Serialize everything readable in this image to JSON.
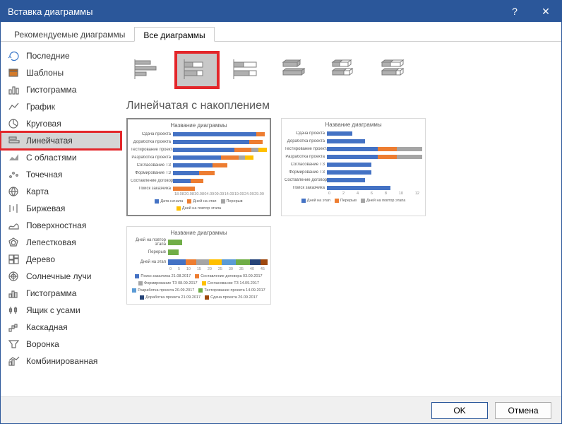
{
  "window": {
    "title": "Вставка диаграммы"
  },
  "tabs": {
    "recommended": "Рекомендуемые диаграммы",
    "all": "Все диаграммы"
  },
  "sidebar": {
    "items": [
      {
        "label": "Последние"
      },
      {
        "label": "Шаблоны"
      },
      {
        "label": "Гистограмма"
      },
      {
        "label": "График"
      },
      {
        "label": "Круговая"
      },
      {
        "label": "Линейчатая"
      },
      {
        "label": "С областями"
      },
      {
        "label": "Точечная"
      },
      {
        "label": "Карта"
      },
      {
        "label": "Биржевая"
      },
      {
        "label": "Поверхностная"
      },
      {
        "label": "Лепестковая"
      },
      {
        "label": "Дерево"
      },
      {
        "label": "Солнечные лучи"
      },
      {
        "label": "Гистограмма"
      },
      {
        "label": "Ящик с усами"
      },
      {
        "label": "Каскадная"
      },
      {
        "label": "Воронка"
      },
      {
        "label": "Комбинированная"
      }
    ]
  },
  "subtitle": "Линейчатая с накоплением",
  "buttons": {
    "ok": "OK",
    "cancel": "Отмена"
  },
  "colors": {
    "s1": "#4472c4",
    "s2": "#ed7d31",
    "s3": "#a5a5a5",
    "s4": "#ffc000",
    "s5": "#5b9bd5",
    "s6": "#70ad47",
    "s7": "#264478",
    "s8": "#9e480e"
  },
  "chart_data": [
    {
      "type": "bar",
      "orientation": "horizontal",
      "stacked": true,
      "title": "Название диаграммы",
      "categories": [
        "Сдача проекта",
        "Доработка проекта",
        "Тестирование проекта",
        "Разработка проекта",
        "Согласование ТЗ",
        "Формирование ТЗ",
        "Составление договора",
        "Поиск заказчика"
      ],
      "series": [
        {
          "name": "Дата начала",
          "values": [
            38,
            35,
            28,
            22,
            18,
            12,
            8,
            0
          ],
          "color": "#4472c4"
        },
        {
          "name": "Дней на этап",
          "values": [
            4,
            6,
            8,
            8,
            7,
            7,
            6,
            10
          ],
          "color": "#ed7d31"
        },
        {
          "name": "Перерыв",
          "values": [
            0,
            0,
            3,
            3,
            0,
            0,
            0,
            0
          ],
          "color": "#a5a5a5"
        },
        {
          "name": "Дней на повтор этапа",
          "values": [
            0,
            0,
            4,
            4,
            0,
            0,
            0,
            0
          ],
          "color": "#ffc000"
        }
      ],
      "xticks": [
        "18.08",
        "20.08",
        "30.08",
        "04.09",
        "09.09",
        "14.09",
        "19.09",
        "24.09",
        "29.09"
      ]
    },
    {
      "type": "bar",
      "orientation": "horizontal",
      "stacked": true,
      "title": "Название диаграммы",
      "categories": [
        "Сдача проекта",
        "Доработка проекта",
        "Тестирование проекта",
        "Разработка проекта",
        "Согласование ТЗ",
        "Формирование ТЗ",
        "Составление договора",
        "Поиск заказчика"
      ],
      "series": [
        {
          "name": "Дней на этап",
          "values": [
            4,
            6,
            8,
            8,
            7,
            7,
            6,
            10
          ],
          "color": "#4472c4"
        },
        {
          "name": "Перерыв",
          "values": [
            0,
            0,
            3,
            3,
            0,
            0,
            0,
            0
          ],
          "color": "#ed7d31"
        },
        {
          "name": "Дней на повтор этапа",
          "values": [
            0,
            0,
            4,
            4,
            0,
            0,
            0,
            0
          ],
          "color": "#a5a5a5"
        }
      ],
      "xticks": [
        "0",
        "2",
        "4",
        "6",
        "8",
        "10",
        "12"
      ]
    },
    {
      "type": "bar",
      "orientation": "horizontal",
      "stacked": true,
      "title": "Название диаграммы",
      "categories": [
        "Дней на повтор этапа",
        "Перерыв",
        "Дней на этап"
      ],
      "series": [
        {
          "name": "Поиск заказчика 21.08.2017",
          "values": [
            0,
            0,
            10
          ],
          "color": "#4472c4"
        },
        {
          "name": "Составление договора 03.09.2017",
          "values": [
            0,
            0,
            6
          ],
          "color": "#ed7d31"
        },
        {
          "name": "Формирование ТЗ 08.09.2017",
          "values": [
            0,
            0,
            7
          ],
          "color": "#a5a5a5"
        },
        {
          "name": "Согласование ТЗ 14.09.2017",
          "values": [
            0,
            0,
            7
          ],
          "color": "#ffc000"
        },
        {
          "name": "Разработка проекта 20.09.2017",
          "values": [
            4,
            3,
            8
          ],
          "color": "#5b9bd5"
        },
        {
          "name": "Тестирование проекта 14.09.2017",
          "values": [
            4,
            3,
            8
          ],
          "color": "#70ad47"
        },
        {
          "name": "Доработка проекта 21.09.2017",
          "values": [
            0,
            0,
            6
          ],
          "color": "#264478"
        },
        {
          "name": "Сдача проекта 26.09.2017",
          "values": [
            0,
            0,
            4
          ],
          "color": "#9e480e"
        }
      ],
      "xticks": [
        "0",
        "5",
        "10",
        "15",
        "20",
        "25",
        "30",
        "35",
        "40",
        "45"
      ]
    }
  ]
}
